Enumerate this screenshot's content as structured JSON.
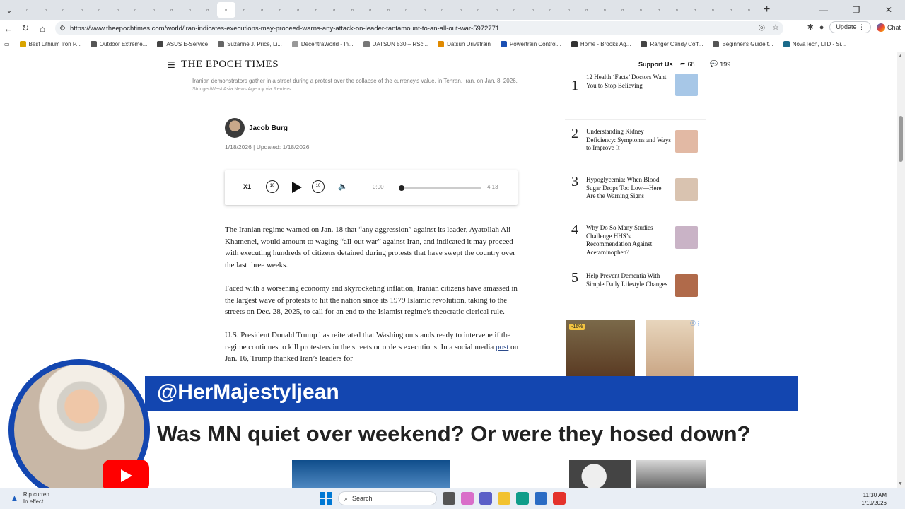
{
  "browser": {
    "url": "https://www.theepochtimes.com/world/iran-indicates-executions-may-proceed-warns-any-attack-on-leader-tantamount-to-an-all-out-war-5972771",
    "update_label": "Update",
    "chat_label": "Chat",
    "tab_count": 41
  },
  "bookmarks": [
    {
      "label": "Best Lithium Iron P...",
      "color": "#d9a400"
    },
    {
      "label": "Outdoor Extreme...",
      "color": "#555555"
    },
    {
      "label": "ASUS E-Service",
      "color": "#444444"
    },
    {
      "label": "Suzanne J. Price, Li...",
      "color": "#666666"
    },
    {
      "label": "DecentraWorld - In...",
      "color": "#999999"
    },
    {
      "label": "DATSUN 530 – RSc...",
      "color": "#777777"
    },
    {
      "label": "Datsun Drivetrain",
      "color": "#e08a00"
    },
    {
      "label": "Powertrain Control...",
      "color": "#1a4fb3"
    },
    {
      "label": "Home - Brooks Ag...",
      "color": "#333333"
    },
    {
      "label": "Ranger Candy Coff...",
      "color": "#444444"
    },
    {
      "label": "Beginner's Guide t...",
      "color": "#555555"
    },
    {
      "label": "NovaTech, LTD - Si...",
      "color": "#1a6a8a"
    }
  ],
  "site": {
    "logo": "THE EPOCH TIMES",
    "support_label": "Support Us",
    "share_count": "68",
    "comment_count": "199"
  },
  "article": {
    "caption": "Iranian demonstrators gather in a street during a protest over the collapse of the currency's value, in Tehran, Iran, on Jan. 8, 2026.",
    "credit": "Stringer/West Asia News Agency via Reuters",
    "author": "Jacob Burg",
    "dates": "1/18/2026  |  Updated: 1/18/2026",
    "paragraphs": [
      "The Iranian regime warned on Jan. 18 that “any aggression” against its leader, Ayatollah Ali Khamenei, would amount to waging “all-out war” against Iran, and indicated it may proceed with executing hundreds of citizens detained during protests that have swept the country over the last three weeks.",
      "Faced with a worsening economy and skyrocketing inflation, Iranian citizens have amassed in the largest wave of protests to hit the nation since its 1979 Islamic revolution, taking to the streets on Dec. 28, 2025, to call for an end to the Islamist regime’s theocratic clerical rule."
    ],
    "p3_before": "U.S. President Donald Trump has reiterated that Washington stands ready to intervene if the regime continues to kill protesters in the streets or orders executions. In a social media ",
    "p3_link": "post",
    "p3_after": " on Jan. 16, Trump thanked Iran’s leaders for"
  },
  "player": {
    "speed": "X1",
    "rewind": "10",
    "forward": "10",
    "current": "0:00",
    "duration": "4:13",
    "progress": 0
  },
  "popular": [
    {
      "num": "1",
      "title": "12 Health ‘Facts’ Doctors Want You to Stop Believing",
      "color": "#a7c7e7"
    },
    {
      "num": "2",
      "title": "Understanding Kidney Deficiency: Symptoms and Ways to Improve It",
      "color": "#e2b9a4"
    },
    {
      "num": "3",
      "title": "Hypoglycemia: When Blood Sugar Drops Too Low—Here Are the Warning Signs",
      "color": "#d9c3b0"
    },
    {
      "num": "4",
      "title": "Why Do So Many Studies Challenge HHS’s Recommendation Against Acetaminophen?",
      "color": "#c9b3c6"
    },
    {
      "num": "5",
      "title": "Help Prevent Dementia With Simple Daily Lifestyle Changes",
      "color": "#b06a4a"
    }
  ],
  "ad": {
    "discount": "-16%"
  },
  "overlay": {
    "handle": "@HerMajestyljean",
    "message": "Was MN quiet over weekend? Or were they hosed down?"
  },
  "taskbar": {
    "weather_line1": "Rip curren...",
    "weather_line2": "In effect",
    "search_label": "Search",
    "time": "11:30 AM",
    "date": "1/19/2026"
  }
}
